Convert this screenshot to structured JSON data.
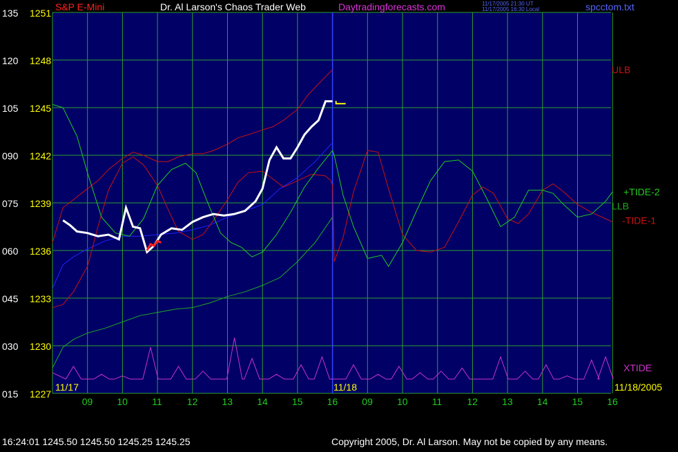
{
  "header": {
    "symbol": "S&P E-Mini",
    "title": "Dr. Al Larson's Chaos Trader Web",
    "site": "Daytradingforecasts.com",
    "time_ut": "11/17/2005 21:30 UT",
    "time_local": "11/17/2005 16:30 Local",
    "file": "spcctom.txt"
  },
  "footer": {
    "quote": "16:24:01  1245.50 1245.50 1245.25 1245.25",
    "copyright": "Copyright 2005, Dr. Al Larson. May not be copied by any means."
  },
  "colors": {
    "background": "#000000",
    "plot_bg": "#000066",
    "grid": "#2ea02e",
    "axis_text": "#ffff00",
    "price": "#ffffff",
    "ulb": "#cc1111",
    "llb": "#22aa22",
    "mavg": "#2222ff",
    "tide2": "#22cc22",
    "tide1": "#cc1111",
    "xtide": "#cc33cc",
    "hour_labels": "#22cc22"
  },
  "chart_data": {
    "type": "line",
    "y_left_labels": [
      "135",
      "120",
      "105",
      "090",
      "075",
      "060",
      "045",
      "030",
      "015"
    ],
    "y_price_labels": [
      "1251",
      "1248",
      "1245",
      "1242",
      "1239",
      "1236",
      "1233",
      "1230",
      "1227"
    ],
    "ylim_price": [
      1227,
      1251
    ],
    "date_labels": [
      "11/17",
      "11/18",
      "11/18/2005"
    ],
    "hour_labels": [
      "09",
      "10",
      "11",
      "12",
      "13",
      "14",
      "15",
      "16",
      "09",
      "10",
      "11",
      "12",
      "13",
      "14",
      "15",
      "16"
    ],
    "series_labels": {
      "ulb": "ULB",
      "tide2": "+TIDE-2",
      "llb": "LLB",
      "tide1": "-TIDE-1",
      "xtide": "XTIDE"
    },
    "last_price": 1245.25,
    "price": {
      "t": [
        8.3,
        8.5,
        8.7,
        9.0,
        9.3,
        9.6,
        9.9,
        10.1,
        10.3,
        10.5,
        10.7,
        10.9,
        11.1,
        11.4,
        11.7,
        12.0,
        12.3,
        12.6,
        12.9,
        13.2,
        13.5,
        13.8,
        14.0,
        14.2,
        14.4,
        14.6,
        14.8,
        15.0,
        15.2,
        15.4,
        15.6,
        15.8,
        16.0
      ],
      "y": [
        1237.9,
        1237.6,
        1237.2,
        1237.1,
        1236.9,
        1237.0,
        1236.7,
        1238.7,
        1237.5,
        1237.4,
        1235.9,
        1236.3,
        1237.0,
        1237.4,
        1237.3,
        1237.8,
        1238.1,
        1238.3,
        1238.2,
        1238.3,
        1238.5,
        1239.1,
        1239.9,
        1241.7,
        1242.5,
        1241.8,
        1241.8,
        1242.5,
        1243.3,
        1243.8,
        1244.2,
        1245.4,
        1245.4
      ]
    },
    "red_segment": {
      "t": [
        10.7,
        10.8,
        10.9,
        11.0,
        11.1
      ],
      "y": [
        1236.0,
        1236.4,
        1236.3,
        1236.6,
        1236.5
      ]
    },
    "ulb": {
      "t": [
        8.0,
        8.3,
        8.6,
        9.0,
        9.3,
        9.6,
        10.0,
        10.3,
        10.6,
        11.0,
        11.3,
        11.6,
        12.0,
        12.3,
        12.6,
        13.0,
        13.3,
        13.6,
        14.0,
        14.3,
        14.6,
        15.0,
        15.3,
        15.6,
        16.0
      ],
      "y": [
        1236.5,
        1238.7,
        1239.2,
        1239.9,
        1240.4,
        1241.1,
        1241.8,
        1242.2,
        1242.0,
        1241.6,
        1241.6,
        1241.9,
        1242.1,
        1242.1,
        1242.3,
        1242.7,
        1243.1,
        1243.3,
        1243.6,
        1243.8,
        1244.2,
        1244.9,
        1245.8,
        1246.5,
        1247.4
      ]
    },
    "mavg": {
      "t": [
        8.0,
        8.3,
        8.6,
        9.0,
        9.5,
        10.0,
        10.5,
        11.0,
        11.5,
        12.0,
        12.5,
        13.0,
        13.5,
        14.0,
        14.5,
        15.0,
        15.5,
        16.0
      ],
      "y": [
        1233.6,
        1235.1,
        1235.6,
        1236.1,
        1236.6,
        1236.9,
        1236.9,
        1237.0,
        1237.1,
        1237.3,
        1237.6,
        1238.1,
        1238.5,
        1238.9,
        1239.9,
        1240.6,
        1241.6,
        1242.8
      ]
    },
    "llb": {
      "t": [
        8.0,
        8.3,
        8.6,
        9.0,
        9.5,
        10.0,
        10.5,
        11.0,
        11.5,
        12.0,
        12.5,
        13.0,
        13.5,
        14.0,
        14.5,
        15.0,
        15.5,
        16.0
      ],
      "y": [
        1228.6,
        1229.9,
        1230.4,
        1230.8,
        1231.1,
        1231.5,
        1231.9,
        1232.1,
        1232.3,
        1232.4,
        1232.7,
        1233.1,
        1233.4,
        1233.8,
        1234.3,
        1235.3,
        1236.5,
        1238.1
      ]
    },
    "tide2": {
      "t": [
        8.0,
        8.3,
        8.7,
        9.0,
        9.4,
        9.8,
        10.2,
        10.6,
        11.0,
        11.4,
        11.8,
        12.1,
        12.4,
        12.8,
        13.1,
        13.4,
        13.7,
        14.0,
        14.4,
        14.8,
        15.2,
        15.6,
        16.0,
        16.05,
        16.3,
        16.6,
        17.0,
        17.4,
        17.6,
        18.0,
        18.4,
        18.8,
        19.2,
        19.6,
        20.0,
        20.4,
        20.8,
        21.2,
        21.6,
        22.0,
        22.3,
        22.6,
        23.0,
        23.4,
        23.8,
        24.0
      ],
      "y": [
        1245.2,
        1245.0,
        1243.2,
        1240.9,
        1238.1,
        1237.1,
        1236.9,
        1238.0,
        1240.1,
        1241.1,
        1241.5,
        1240.9,
        1239.2,
        1237.1,
        1236.5,
        1236.2,
        1235.6,
        1235.9,
        1237.0,
        1238.4,
        1240.0,
        1241.2,
        1242.3,
        1242.0,
        1239.5,
        1237.5,
        1235.5,
        1235.7,
        1235.0,
        1236.5,
        1238.5,
        1240.4,
        1241.6,
        1241.7,
        1241.0,
        1239.3,
        1237.5,
        1238.1,
        1239.8,
        1239.8,
        1239.6,
        1238.9,
        1238.1,
        1238.3,
        1239.1,
        1239.7
      ]
    },
    "tide1": {
      "t": [
        8.0,
        8.3,
        8.6,
        9.0,
        9.3,
        9.6,
        10.0,
        10.3,
        10.6,
        11.0,
        11.3,
        11.6,
        12.0,
        12.3,
        12.6,
        13.0,
        13.3,
        13.6,
        14.0,
        14.3,
        14.6,
        15.0,
        15.4,
        15.8,
        15.95,
        16.0,
        16.05,
        16.3,
        16.6,
        17.0,
        17.3,
        17.6,
        18.0,
        18.4,
        18.8,
        19.2,
        19.6,
        20.0,
        20.3,
        20.6,
        21.0,
        21.3,
        21.6,
        22.0,
        22.3,
        22.6,
        23.0,
        23.4,
        23.8,
        24.0
      ],
      "y": [
        1232.4,
        1232.6,
        1233.4,
        1235.0,
        1237.5,
        1239.8,
        1241.5,
        1241.9,
        1241.4,
        1240.1,
        1238.6,
        1237.2,
        1236.7,
        1237.0,
        1237.9,
        1239.2,
        1240.3,
        1240.9,
        1241.0,
        1240.5,
        1240.0,
        1240.4,
        1240.8,
        1240.7,
        1240.4,
        1240.1,
        1235.3,
        1236.8,
        1239.7,
        1242.3,
        1242.2,
        1239.9,
        1237.0,
        1236.0,
        1235.9,
        1236.2,
        1237.8,
        1239.5,
        1240.0,
        1239.6,
        1238.0,
        1237.7,
        1238.3,
        1239.8,
        1240.2,
        1239.7,
        1238.9,
        1238.4,
        1238.0,
        1237.8
      ]
    },
    "xtide_peaks": {
      "t": [
        8.6,
        9.4,
        10.0,
        10.8,
        11.6,
        12.3,
        13.2,
        13.7,
        14.4,
        15.1,
        15.7,
        16.6,
        17.3,
        17.9,
        18.5,
        19.1,
        19.7,
        20.8,
        21.5,
        22.1,
        22.7,
        23.4,
        23.8
      ],
      "y": [
        1228.7,
        1228.2,
        1228.1,
        1229.9,
        1228.7,
        1228.4,
        1230.5,
        1229.2,
        1228.2,
        1228.8,
        1229.3,
        1228.8,
        1228.2,
        1228.7,
        1228.3,
        1228.4,
        1228.6,
        1229.3,
        1228.4,
        1228.8,
        1228.1,
        1229.1,
        1229.3
      ]
    }
  }
}
